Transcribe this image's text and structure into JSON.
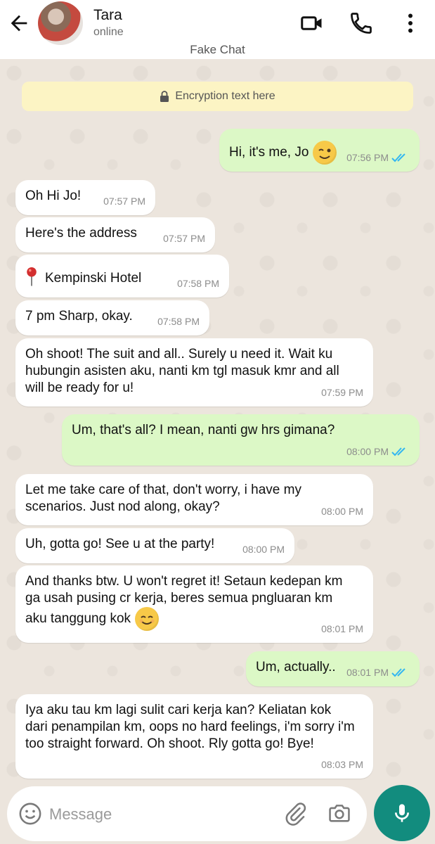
{
  "contact": {
    "name": "Tara",
    "status": "online"
  },
  "chat_label": "Fake Chat",
  "encryption_text": "Encryption text here",
  "messages": [
    {
      "direction": "out",
      "text": "Hi, it's me, Jo",
      "emoji": "winking-face",
      "time": "07:56 PM",
      "read": true
    },
    {
      "direction": "in",
      "text": "Oh Hi Jo!",
      "time": "07:57 PM"
    },
    {
      "direction": "in",
      "text": "Here's the address",
      "time": "07:57 PM"
    },
    {
      "direction": "in",
      "text": "Kempinski Hotel",
      "emoji": "round-pushpin",
      "time": "07:58 PM"
    },
    {
      "direction": "in",
      "text": "7 pm Sharp, okay.",
      "time": "07:58 PM"
    },
    {
      "direction": "in",
      "text": "Oh shoot! The suit and all.. Surely u need it. Wait ku hubungin asisten aku, nanti km tgl masuk kmr and all will be ready for u!",
      "time": "07:59 PM"
    },
    {
      "direction": "out",
      "text": "Um, that's all? I mean, nanti gw hrs gimana?",
      "time": "08:00 PM",
      "read": true
    },
    {
      "direction": "in",
      "text": "Let me take care of that, don't worry, i have my scenarios. Just nod along, okay?",
      "time": "08:00 PM"
    },
    {
      "direction": "in",
      "text": "Uh, gotta go! See u at the party!",
      "time": "08:00 PM"
    },
    {
      "direction": "in",
      "text": "And thanks btw. U won't regret it! Setaun kedepan km ga usah pusing cr kerja, beres semua pngluaran km aku tanggung kok",
      "emoji": "smiling-face",
      "time": "08:01 PM"
    },
    {
      "direction": "out",
      "text": "Um, actually..",
      "time": "08:01 PM",
      "read": true
    },
    {
      "direction": "in",
      "text": "Iya aku tau km lagi sulit cari kerja kan? Keliatan kok dari penampilan km, oops no hard feelings, i'm sorry i'm too straight forward. Oh shoot. Rly gotta go! Bye!",
      "time": "08:03 PM"
    }
  ],
  "input": {
    "placeholder": "Message",
    "value": ""
  },
  "icons": {
    "back": "arrow-left-icon",
    "video": "video-camera-icon",
    "call": "phone-icon",
    "menu": "more-vertical-icon",
    "emoji": "emoji-smile-icon",
    "attach": "paperclip-icon",
    "camera": "camera-icon",
    "mic": "microphone-icon",
    "lock": "lock-icon"
  },
  "colors": {
    "incoming_bubble": "#ffffff",
    "outgoing_bubble": "#dcf8c6",
    "read_ticks": "#34b7f1",
    "mic_button": "#128c7e",
    "encryption_banner": "#fcf4c4"
  }
}
